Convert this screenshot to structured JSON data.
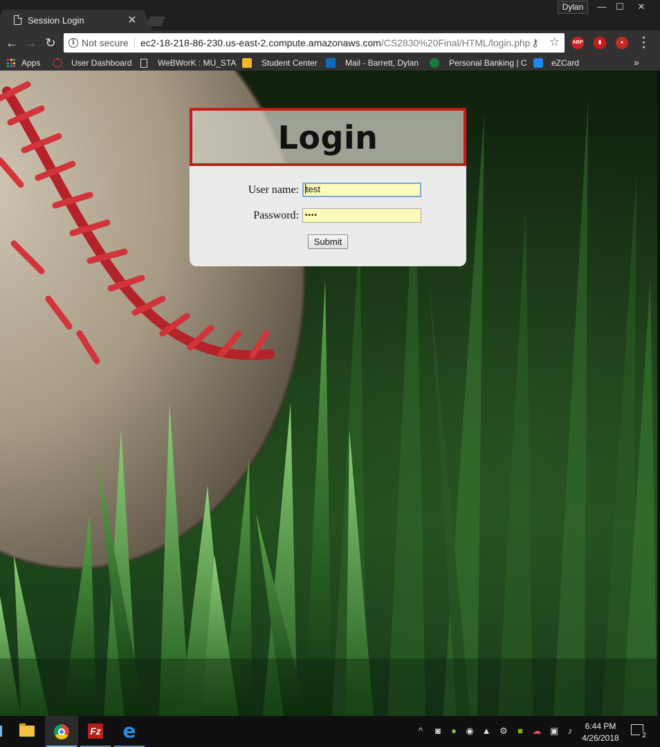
{
  "browser": {
    "tab_title": "Session Login",
    "profile_name": "Dylan",
    "security_label": "Not secure",
    "url_host": "ec2-18-218-86-230.us-east-2.compute.amazonaws.com",
    "url_path": "/CS2830%20Final/HTML/login.php",
    "extensions": [
      "adblock-plus-icon",
      "shield-extension-icon",
      "red-mascot-extension-icon"
    ],
    "bookmarks": [
      {
        "label": "Apps",
        "icon": "apps-grid-icon"
      },
      {
        "label": "User Dashboard",
        "icon": "dashboard-ring-icon"
      },
      {
        "label": "WeBWorK : MU_STA",
        "icon": "page-icon"
      },
      {
        "label": "Student Center",
        "icon": "student-center-icon"
      },
      {
        "label": "Mail - Barrett, Dylan",
        "icon": "outlook-icon"
      },
      {
        "label": "Personal Banking | C",
        "icon": "bank-icon"
      },
      {
        "label": "eZCard",
        "icon": "ezcard-icon"
      }
    ]
  },
  "login": {
    "title": "Login",
    "username_label": "User name:",
    "username_value": "test",
    "password_label": "Password:",
    "password_mask": "••••",
    "submit_label": "Submit"
  },
  "taskbar": {
    "apps": [
      "file-explorer-icon",
      "chrome-icon",
      "filezilla-icon",
      "edge-icon"
    ],
    "active_app": "chrome-icon",
    "time": "6:44 PM",
    "date": "4/26/2018",
    "notification_count": "2"
  },
  "colors": {
    "login_border": "#c61b17",
    "input_fill": "#fafbb8",
    "focus_ring": "#7ea3d8",
    "chrome_dark": "#323232"
  }
}
